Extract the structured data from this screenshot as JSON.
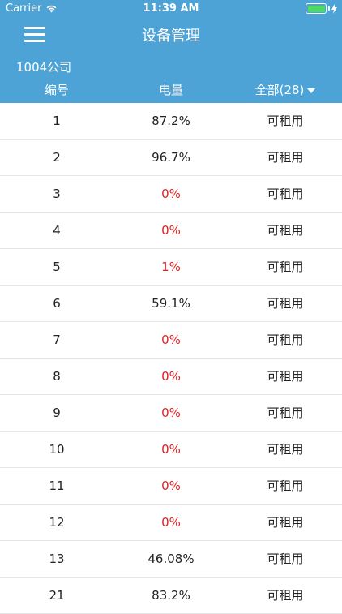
{
  "status_bar": {
    "carrier": "Carrier",
    "time": "11:39 AM",
    "wifi_icon": "wifi-icon",
    "battery_icon": "battery-icon"
  },
  "nav": {
    "title": "设备管理",
    "menu_icon": "hamburger-menu-icon"
  },
  "company": "1004公司",
  "columns": {
    "id": "编号",
    "power": "电量",
    "status": "全部(28)"
  },
  "colors": {
    "header": "#4ea3d6",
    "low_battery": "#e02020",
    "battery_fill": "#4cd964"
  },
  "rows": [
    {
      "id": "1",
      "power": "87.2%",
      "low": false,
      "status": "可租用"
    },
    {
      "id": "2",
      "power": "96.7%",
      "low": false,
      "status": "可租用"
    },
    {
      "id": "3",
      "power": "0%",
      "low": true,
      "status": "可租用"
    },
    {
      "id": "4",
      "power": "0%",
      "low": true,
      "status": "可租用"
    },
    {
      "id": "5",
      "power": "1%",
      "low": true,
      "status": "可租用"
    },
    {
      "id": "6",
      "power": "59.1%",
      "low": false,
      "status": "可租用"
    },
    {
      "id": "7",
      "power": "0%",
      "low": true,
      "status": "可租用"
    },
    {
      "id": "8",
      "power": "0%",
      "low": true,
      "status": "可租用"
    },
    {
      "id": "9",
      "power": "0%",
      "low": true,
      "status": "可租用"
    },
    {
      "id": "10",
      "power": "0%",
      "low": true,
      "status": "可租用"
    },
    {
      "id": "11",
      "power": "0%",
      "low": true,
      "status": "可租用"
    },
    {
      "id": "12",
      "power": "0%",
      "low": true,
      "status": "可租用"
    },
    {
      "id": "13",
      "power": "46.08%",
      "low": false,
      "status": "可租用"
    },
    {
      "id": "21",
      "power": "83.2%",
      "low": false,
      "status": "可租用"
    }
  ]
}
